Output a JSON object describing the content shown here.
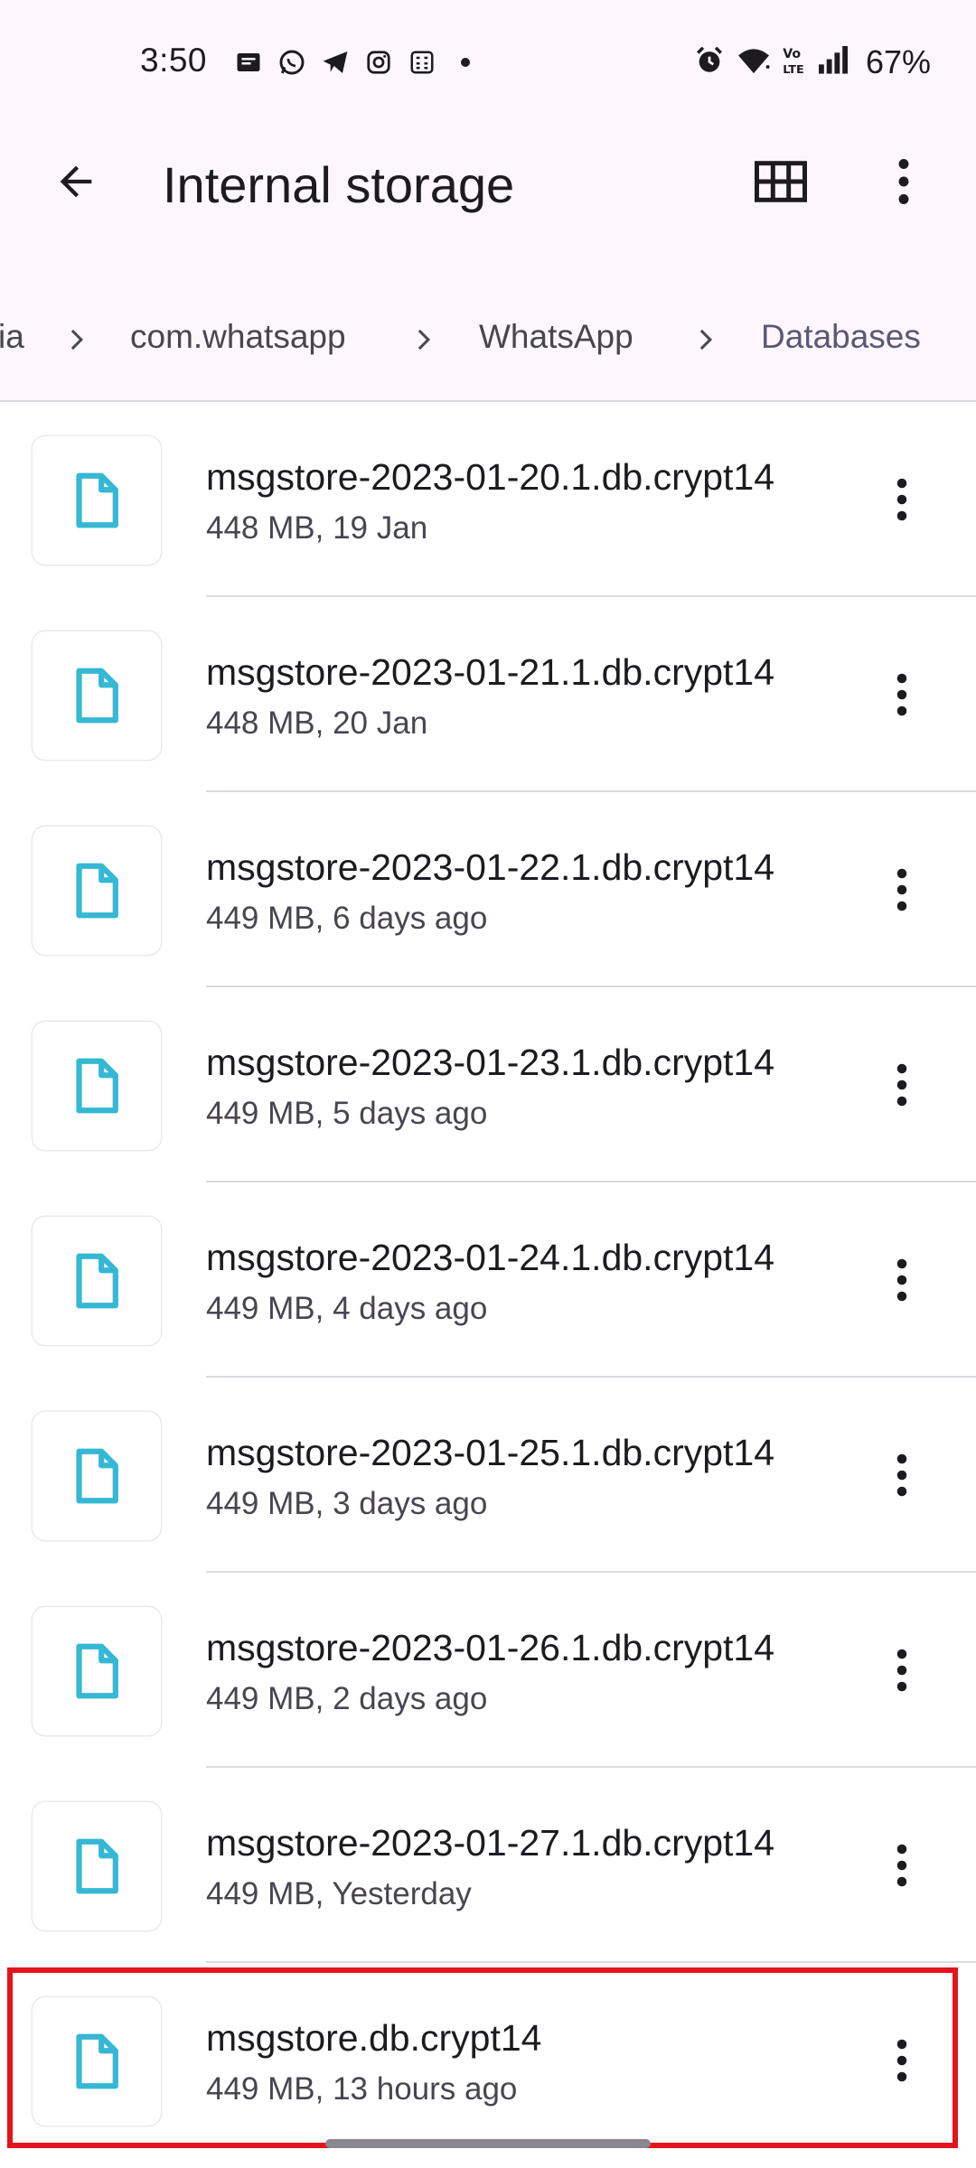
{
  "status_bar": {
    "time": "3:50",
    "battery": "67%",
    "notification_icons": [
      "message-icon",
      "whatsapp-icon",
      "telegram-icon",
      "instagram-icon",
      "calculator-icon",
      "dot-icon"
    ],
    "system_icons": [
      "alarm-icon",
      "wifi-icon",
      "volte-icon",
      "signal-icon"
    ]
  },
  "app_bar": {
    "title": "Internal storage",
    "back_icon": "back-arrow-icon",
    "grid_icon": "grid-view-icon",
    "more_icon": "more-vert-icon"
  },
  "breadcrumb": {
    "items": [
      "ia",
      "com.whatsapp",
      "WhatsApp",
      "Databases"
    ],
    "current_color": "#5a5873"
  },
  "files": [
    {
      "name": "msgstore-2023-01-20.1.db.crypt14",
      "meta": "448 MB, 19 Jan"
    },
    {
      "name": "msgstore-2023-01-21.1.db.crypt14",
      "meta": "448 MB, 20 Jan"
    },
    {
      "name": "msgstore-2023-01-22.1.db.crypt14",
      "meta": "449 MB, 6 days ago"
    },
    {
      "name": "msgstore-2023-01-23.1.db.crypt14",
      "meta": "449 MB, 5 days ago"
    },
    {
      "name": "msgstore-2023-01-24.1.db.crypt14",
      "meta": "449 MB, 4 days ago"
    },
    {
      "name": "msgstore-2023-01-25.1.db.crypt14",
      "meta": "449 MB, 3 days ago"
    },
    {
      "name": "msgstore-2023-01-26.1.db.crypt14",
      "meta": "449 MB, 2 days ago"
    },
    {
      "name": "msgstore-2023-01-27.1.db.crypt14",
      "meta": "449 MB, Yesterday"
    },
    {
      "name": "msgstore.db.crypt14",
      "meta": "449 MB, 13 hours ago"
    }
  ],
  "colors": {
    "file_icon": "#35b8d4",
    "highlight_border": "#e3141b",
    "header_bg": "#fdf7fd"
  }
}
